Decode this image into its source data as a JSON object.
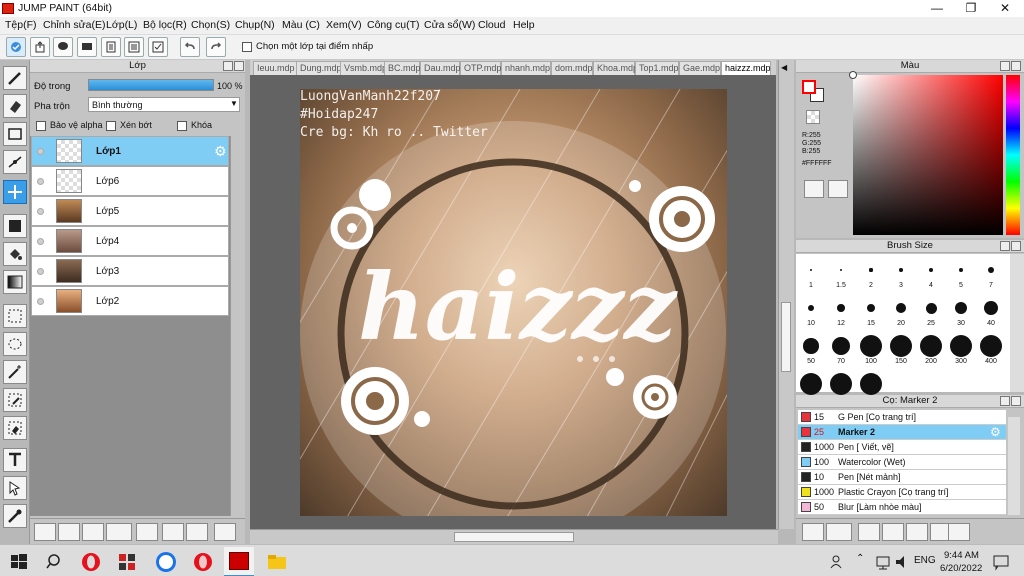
{
  "window": {
    "title": "JUMP PAINT (64bit)"
  },
  "menu": [
    "Tệp(F)",
    "Chỉnh sửa(E)",
    "Lớp(L)",
    "Bộ lọc(R)",
    "Chọn(S)",
    "Chụp(N)",
    "Màu (C)",
    "Xem(V)",
    "Công cụ(T)",
    "Cửa sổ(W)",
    "Cloud",
    "Help"
  ],
  "commandbar": {
    "select_layer_label": "Chọn một lớp tại điểm nhấp"
  },
  "layer_panel": {
    "title": "Lớp",
    "opacity_label": "Độ trong",
    "opacity_value": "100 %",
    "opacity_percent": 100,
    "blend_label": "Pha trộn",
    "blend_value": "Bình thường",
    "protect_alpha": "Bảo vệ alpha",
    "clip": "Xén bớt",
    "lock": "Khóa",
    "layers": [
      {
        "name": "Lớp1",
        "selected": true
      },
      {
        "name": "Lớp6"
      },
      {
        "name": "Lớp5"
      },
      {
        "name": "Lớp4"
      },
      {
        "name": "Lớp3"
      },
      {
        "name": "Lớp2"
      }
    ]
  },
  "tabs": [
    "Ieuu.mdp",
    "Dung.mdp",
    "Vsmb.mdp",
    "BC.mdp",
    "Dau.mdp",
    "OTP.mdp",
    "nhanh.mdp",
    "dom.mdp",
    "Khoa.mdp",
    "Top1.mdp",
    "Gae.mdp",
    "haizzz.mdp"
  ],
  "artwork": {
    "watermark": [
      "LuongVanManh22f207",
      "#Hoidap247",
      "Cre bg: Kh ro .. Twitter"
    ],
    "title_text": "haizzz"
  },
  "color_panel": {
    "title": "Màu",
    "r": "R:255",
    "g": "G:255",
    "b": "B:255",
    "hex": "#FFFFFF",
    "primary": "#ff0000",
    "secondary": "#ffffff"
  },
  "brush_size": {
    "title": "Brush Size",
    "sizes": [
      "1",
      "1.5",
      "2",
      "3",
      "4",
      "5",
      "7",
      "10",
      "12",
      "15",
      "20",
      "25",
      "30",
      "40",
      "50",
      "70",
      "100",
      "150",
      "200",
      "300",
      "400"
    ]
  },
  "brush_list": {
    "title": "Cọ: Marker 2",
    "items": [
      {
        "size": "15",
        "name": "G Pen [Cọ trang trí]",
        "color": "#e8323c"
      },
      {
        "size": "25",
        "name": "Marker 2",
        "color": "#e8323c",
        "selected": true
      },
      {
        "size": "1000",
        "name": "Pen [ Viết, vẽ]",
        "color": "#222222"
      },
      {
        "size": "100",
        "name": "Watercolor (Wet)",
        "color": "#7fcdf4"
      },
      {
        "size": "10",
        "name": "Pen [Nét mảnh]",
        "color": "#222222"
      },
      {
        "size": "1000",
        "name": "Plastic Crayon [Cọ trang trí]",
        "color": "#f2e21c"
      },
      {
        "size": "50",
        "name": "Blur [Làm nhòe màu]",
        "color": "#f4b6d6"
      }
    ]
  },
  "taskbar": {
    "lang": "ENG",
    "time": "9:44 AM",
    "date": "6/20/2022"
  }
}
